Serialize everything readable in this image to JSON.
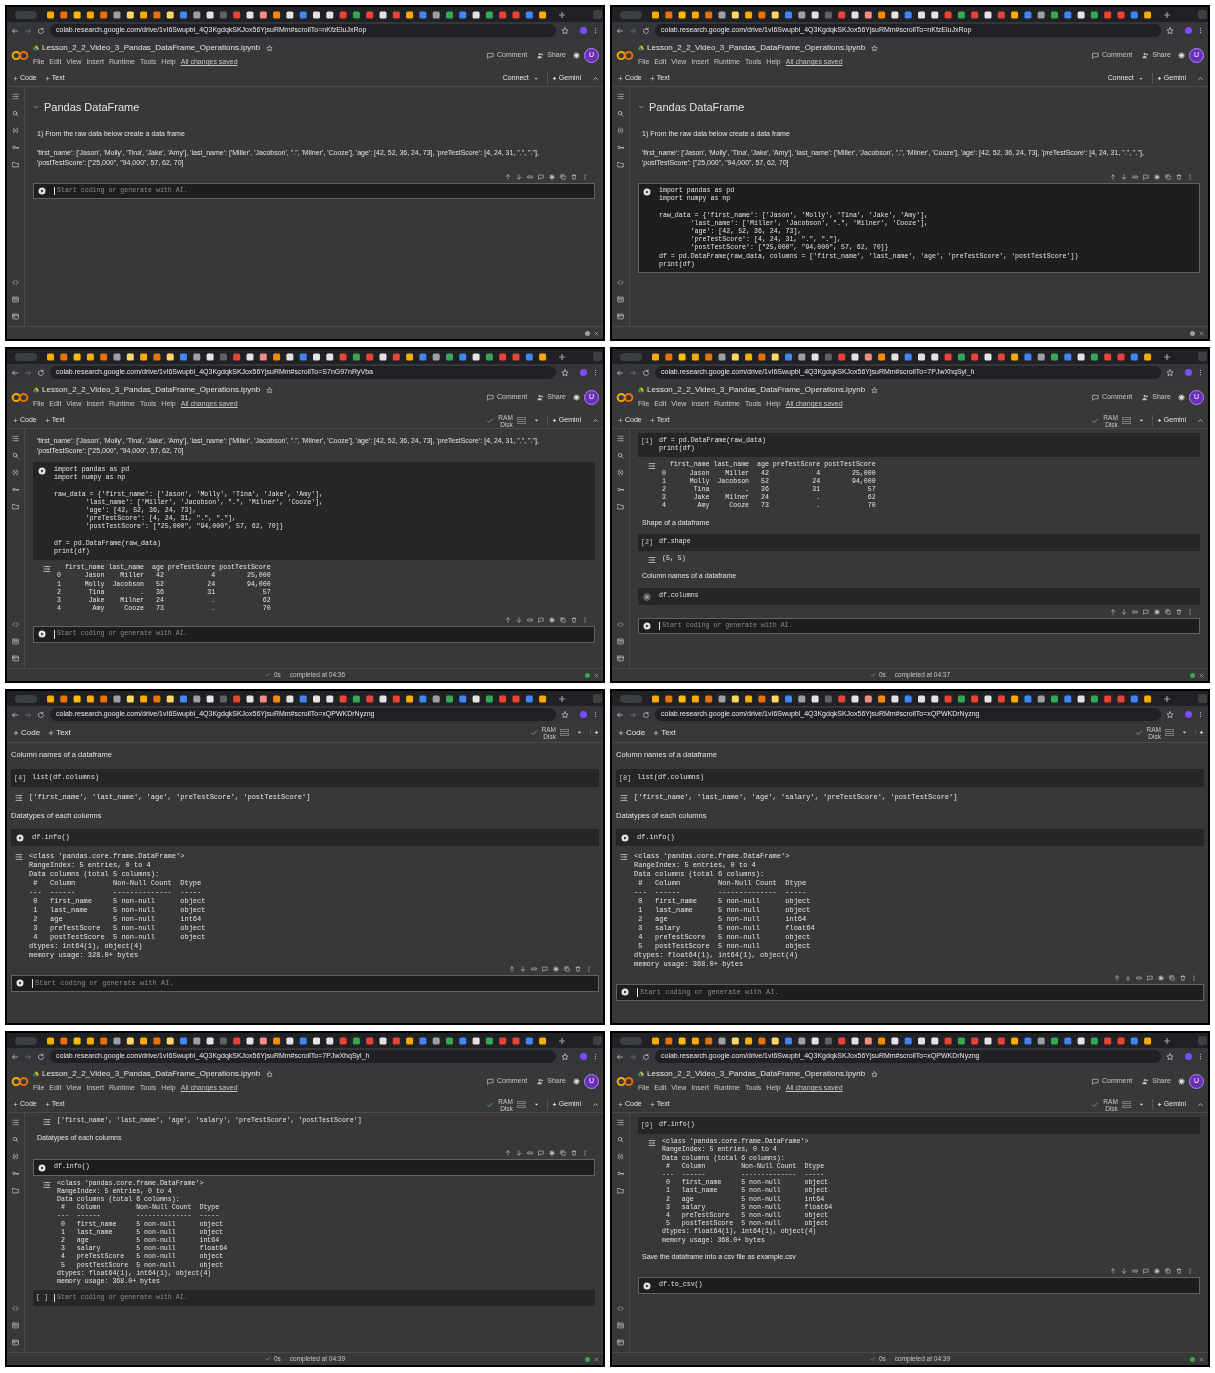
{
  "panels": [
    {
      "kind": "full",
      "url": "colab.research.google.com/drive/1vI6Swupbl_4Q3KgdqkSKJox56YjsuRMm#scrollTo=nKfzEluJxRop",
      "header": {
        "title": "Lesson_2_2_Video_3_Pandas_DataFrame_Operations.ipynb",
        "menus": [
          "File",
          "Edit",
          "View",
          "Insert",
          "Runtime",
          "Tools",
          "Help"
        ],
        "saved": "All changes saved",
        "comment": "Comment",
        "share": "Share",
        "avatar": "U"
      },
      "toolbar": {
        "code": "Code",
        "text": "Text",
        "runtime": {
          "kind": "connect",
          "label": "Connect"
        },
        "gemini": "Gemini"
      },
      "cells": [
        {
          "kind": "heading",
          "text": "Pandas DataFrame"
        },
        {
          "kind": "text",
          "text": "1) From the raw data below create a data frame"
        },
        {
          "kind": "text",
          "text": "'first_name': ['Jason', 'Molly', 'Tina', 'Jake', 'Amy'], 'last_name': ['Miller', 'Jacobson', \".\", 'Milner', 'Cooze'], 'age': [42, 52, 36, 24, 73], 'preTestScore': [4, 24, 31, \".\", \".\"], 'postTestScore': [\"25,000\", \"94,000\", 57, 62, 70]"
        },
        {
          "kind": "code",
          "selected": true,
          "placeholder": "Start coding or generate with AI."
        }
      ]
    },
    {
      "kind": "full",
      "url": "colab.research.google.com/drive/1vI6Swupbl_4Q3KgdqkSKJox56YjsuRMm#scrollTo=nKfzEluJxRop",
      "header": {
        "title": "Lesson_2_2_Video_3_Pandas_DataFrame_Operations.ipynb",
        "menus": [
          "File",
          "Edit",
          "View",
          "Insert",
          "Runtime",
          "Tools",
          "Help"
        ],
        "saved": "All changes saved",
        "comment": "Comment",
        "share": "Share",
        "avatar": "U"
      },
      "toolbar": {
        "code": "Code",
        "text": "Text",
        "runtime": {
          "kind": "connect",
          "label": "Connect"
        },
        "gemini": "Gemini"
      },
      "cells": [
        {
          "kind": "heading",
          "text": "Pandas DataFrame"
        },
        {
          "kind": "text",
          "text": "1) From the raw data below create a data frame"
        },
        {
          "kind": "text",
          "text": "'first_name': ['Jason', 'Molly', 'Tina', 'Jake', 'Amy'], 'last_name': ['Miller', 'Jacobson', \".\", 'Milner', 'Cooze'], 'age': [42, 52, 36, 24, 73], 'preTestScore': [4, 24, 31, \".\", \".\"], 'postTestScore': [\"25,000\", \"94,000\", 57, 62, 70]"
        },
        {
          "kind": "code",
          "selected": true,
          "code": "import pandas as pd\nimport numpy as np\n\nraw_data = {'first_name': ['Jason', 'Molly', 'Tina', 'Jake', 'Amy'],\n        'last_name': ['Miller', 'Jacobson', \".\", 'Milner', 'Cooze'],\n        'age': [42, 52, 36, 24, 73],\n        'preTestScore': [4, 24, 31, \".\", \".\"],\n        'postTestScore': [\"25,000\", \"94,000\", 57, 62, 70]}\ndf = pd.DataFrame(raw_data, columns = ['first_name', 'last_name', 'age', 'preTestScore', 'postTestScore'])\nprint(df)"
        }
      ]
    },
    {
      "kind": "full",
      "url": "colab.research.google.com/drive/1vI6Swupbl_4Q3KgdqkSKJox56YjsuRMm#scrollTo=S7nG97nRyVba",
      "header": {
        "title": "Lesson_2_2_Video_3_Pandas_DataFrame_Operations.ipynb",
        "menus": [
          "File",
          "Edit",
          "View",
          "Insert",
          "Runtime",
          "Tools",
          "Help"
        ],
        "saved": "All changes saved",
        "comment": "Comment",
        "share": "Share",
        "avatar": "U"
      },
      "toolbar": {
        "code": "Code",
        "text": "Text",
        "runtime": {
          "kind": "resources",
          "ram": "RAM",
          "disk": "Disk"
        },
        "gemini": "Gemini"
      },
      "cells": [
        {
          "kind": "text",
          "text": "'first_name': ['Jason', 'Molly', 'Tina', 'Jake', 'Amy'], 'last_name': ['Miller', 'Jacobson', \".\", 'Milner', 'Cooze'], 'age': [42, 52, 36, 24, 73], 'preTestScore': [4, 24, 31, \".\", \".\"], 'postTestScore': [\"25,000\", \"94,000\", 57, 62, 70]"
        },
        {
          "kind": "code",
          "selected": false,
          "code": "import pandas as pd\nimport numpy as np\n\nraw_data = {'first_name': ['Jason', 'Molly', 'Tina', 'Jake', 'Amy'],\n        'last_name': ['Miller', 'Jacobson', \".\", 'Milner', 'Cooze'],\n        'age': [42, 52, 36, 24, 73],\n        'preTestScore': [4, 24, 31, \".\", \".\"],\n        'postTestScore': [\"25,000\", \"94,000\", 57, 62, 70]}\n\ndf = pd.DataFrame(raw_data)\nprint(df)"
        },
        {
          "kind": "output",
          "text": "  first_name last_name  age preTestScore postTestScore\n0      Jason    Miller   42            4        25,000\n1      Molly  Jacobson   52           24        94,000\n2       Tina         .   36           31            57\n3       Jake    Milner   24            .            62\n4        Amy     Cooze   73            .            70"
        },
        {
          "kind": "code",
          "selected": true,
          "placeholder": "Start coding or generate with AI."
        }
      ],
      "status": {
        "time": "0s",
        "completed": "completed at 04:36"
      }
    },
    {
      "kind": "full",
      "url": "colab.research.google.com/drive/1vI6Swupbl_4Q3KgdqkSKJox56YjsuRMm#scrollTo=7PJwXhqSyl_h",
      "header": {
        "title": "Lesson_2_2_Video_3_Pandas_DataFrame_Operations.ipynb",
        "menus": [
          "File",
          "Edit",
          "View",
          "Insert",
          "Runtime",
          "Tools",
          "Help"
        ],
        "saved": "All changes saved",
        "comment": "Comment",
        "share": "Share",
        "avatar": "U"
      },
      "toolbar": {
        "code": "Code",
        "text": "Text",
        "runtime": {
          "kind": "resources",
          "ram": "RAM",
          "disk": "Disk"
        },
        "gemini": "Gemini"
      },
      "cells": [
        {
          "kind": "code",
          "selected": false,
          "label": "[1]",
          "code": "df = pd.DataFrame(raw_data)\nprint(df)"
        },
        {
          "kind": "output",
          "text": "  first_name last_name  age preTestScore postTestScore\n0      Jason    Miller   42            4        25,000\n1      Molly  Jacobson   52           24        94,000\n2       Tina         .   36           31            57\n3       Jake    Milner   24            .            62\n4        Amy     Cooze   73            .            70"
        },
        {
          "kind": "text",
          "text": "Shape of a dataframe"
        },
        {
          "kind": "code",
          "selected": false,
          "label": "[2]",
          "code": "df.shape"
        },
        {
          "kind": "output",
          "text": "(5, 5)"
        },
        {
          "kind": "text",
          "text": "Column names of a dataframe"
        },
        {
          "kind": "code",
          "selected": false,
          "code": "df.columns"
        },
        {
          "kind": "code",
          "selected": true,
          "placeholder": "Start coding or generate with AI."
        }
      ],
      "status": {
        "time": "0s",
        "completed": "completed at 04:37"
      }
    },
    {
      "kind": "zoomed",
      "url": "colab.research.google.com/drive/1vI6Swupbl_4Q3KgdqkSKJox56YjsuRMm#scrollTo=xQPWKDrNyzng",
      "toolbar": {
        "code": "Code",
        "text": "Text",
        "runtime": {
          "kind": "resources",
          "ram": "RAM",
          "disk": "Disk"
        }
      },
      "cells": [
        {
          "kind": "text",
          "text": "Column names of a dataframe"
        },
        {
          "kind": "code",
          "selected": false,
          "label": "[4]",
          "code": "list(df.columns)"
        },
        {
          "kind": "output",
          "text": "['first_name', 'last_name', 'age', 'preTestScore', 'postTestScore']"
        },
        {
          "kind": "text",
          "text": "Datatypes of each columns"
        },
        {
          "kind": "code",
          "selected": false,
          "code": "df.info()"
        },
        {
          "kind": "output",
          "text": "<class 'pandas.core.frame.DataFrame'>\nRangeIndex: 5 entries, 0 to 4\nData columns (total 5 columns):\n #   Column         Non-Null Count  Dtype\n---  ------         --------------  -----\n 0   first_name     5 non-null      object\n 1   last_name      5 non-null      object\n 2   age            5 non-null      int64\n 3   preTestScore   5 non-null      object\n 4   postTestScore  5 non-null      object\ndtypes: int64(1), object(4)\nmemory usage: 328.0+ bytes"
        },
        {
          "kind": "code",
          "selected": true,
          "placeholder": "Start coding or generate with AI."
        }
      ]
    },
    {
      "kind": "zoomed",
      "url": "colab.research.google.com/drive/1vI6Swupbl_4Q3KgdqkSKJox56YjsuRMm#scrollTo=xQPWKDrNyzng",
      "toolbar": {
        "code": "Code",
        "text": "Text",
        "runtime": {
          "kind": "resources",
          "ram": "RAM",
          "disk": "Disk"
        }
      },
      "cells": [
        {
          "kind": "text",
          "text": "Column names of a dataframe"
        },
        {
          "kind": "code",
          "selected": false,
          "label": "[8]",
          "code": "list(df.columns)"
        },
        {
          "kind": "output",
          "text": "['first_name', 'last_name', 'age', 'salary', 'preTestScore', 'postTestScore']"
        },
        {
          "kind": "text",
          "text": "Datatypes of each columns"
        },
        {
          "kind": "code",
          "selected": false,
          "code": "df.info()"
        },
        {
          "kind": "output",
          "text": "<class 'pandas.core.frame.DataFrame'>\nRangeIndex: 5 entries, 0 to 4\nData columns (total 6 columns):\n #   Column         Non-Null Count  Dtype\n---  ------         --------------  -----\n 0   first_name     5 non-null      object\n 1   last_name      5 non-null      object\n 2   age            5 non-null      int64\n 3   salary         5 non-null      float64\n 4   preTestScore   5 non-null      object\n 5   postTestScore  5 non-null      object\ndtypes: float64(1), int64(1), object(4)\nmemory usage: 368.0+ bytes"
        },
        {
          "kind": "code",
          "selected": true,
          "placeholder": "Start coding or generate with AI."
        }
      ]
    },
    {
      "kind": "full",
      "url": "colab.research.google.com/drive/1vI6Swupbl_4Q3KgdqkSKJox56YjsuRMm#scrollTo=7PJwXhqSyl_h",
      "header": {
        "title": "Lesson_2_2_Video_3_Pandas_DataFrame_Operations.ipynb",
        "menus": [
          "File",
          "Edit",
          "View",
          "Insert",
          "Runtime",
          "Tools",
          "Help"
        ],
        "saved": "All changes saved",
        "comment": "Comment",
        "share": "Share",
        "avatar": "U"
      },
      "toolbar": {
        "code": "Code",
        "text": "Text",
        "runtime": {
          "kind": "resources",
          "ram": "RAM",
          "disk": "Disk"
        },
        "gemini": "Gemini"
      },
      "cells": [
        {
          "kind": "output",
          "text": "['first_name', 'last_name', 'age', 'salary', 'preTestScore', 'postTestScore']"
        },
        {
          "kind": "text",
          "text": "Datatypes of each columns"
        },
        {
          "kind": "code",
          "selected": true,
          "code": "df.info()"
        },
        {
          "kind": "output",
          "text": "<class 'pandas.core.frame.DataFrame'>\nRangeIndex: 5 entries, 0 to 4\nData columns (total 6 columns):\n #   Column         Non-Null Count  Dtype\n---  ------         --------------  -----\n 0   first_name     5 non-null      object\n 1   last_name      5 non-null      object\n 2   age            5 non-null      int64\n 3   salary         5 non-null      float64\n 4   preTestScore   5 non-null      object\n 5   postTestScore  5 non-null      object\ndtypes: float64(1), int64(1), object(4)\nmemory usage: 368.0+ bytes"
        },
        {
          "kind": "code",
          "selected": false,
          "label": "[ ]",
          "placeholder": "Start coding or generate with AI."
        }
      ],
      "status": {
        "time": "0s",
        "completed": "completed at 04:39"
      }
    },
    {
      "kind": "full",
      "url": "colab.research.google.com/drive/1vI6Swupbl_4Q3KgdqkSKJox56YjsuRMm#scrollTo=xQPWKDrNyzng",
      "header": {
        "title": "Lesson_2_2_Video_3_Pandas_DataFrame_Operations.ipynb",
        "menus": [
          "File",
          "Edit",
          "View",
          "Insert",
          "Runtime",
          "Tools",
          "Help"
        ],
        "saved": "All changes saved",
        "comment": "Comment",
        "share": "Share",
        "avatar": "U"
      },
      "toolbar": {
        "code": "Code",
        "text": "Text",
        "runtime": {
          "kind": "resources",
          "ram": "RAM",
          "disk": "Disk"
        },
        "gemini": "Gemini"
      },
      "cells": [
        {
          "kind": "code",
          "selected": false,
          "label": "[9]",
          "code": "df.info()"
        },
        {
          "kind": "output",
          "text": "<class 'pandas.core.frame.DataFrame'>\nRangeIndex: 5 entries, 0 to 4\nData columns (total 6 columns):\n #   Column         Non-Null Count  Dtype\n---  ------         --------------  -----\n 0   first_name     5 non-null      object\n 1   last_name      5 non-null      object\n 2   age            5 non-null      int64\n 3   salary         5 non-null      float64\n 4   preTestScore   5 non-null      object\n 5   postTestScore  5 non-null      object\ndtypes: float64(1), int64(1), object(4)\nmemory usage: 368.0+ bytes"
        },
        {
          "kind": "text",
          "text": "Save the dataframe into a csv file as example.csv"
        },
        {
          "kind": "code",
          "selected": true,
          "code": "df.to_csv()"
        }
      ],
      "status": {
        "time": "0s",
        "completed": "completed at 04:39"
      }
    }
  ]
}
